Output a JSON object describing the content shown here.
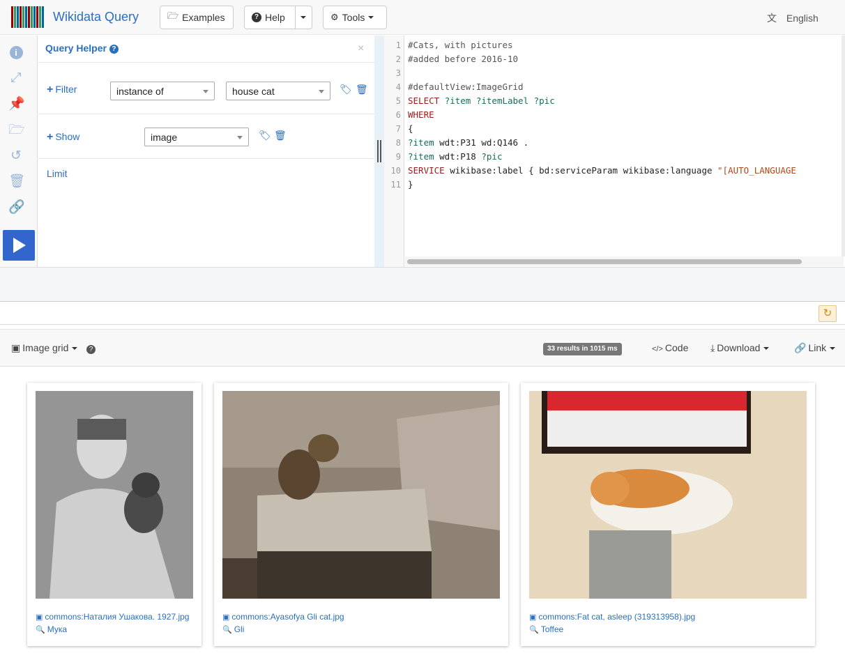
{
  "navbar": {
    "brand": "Wikidata Query",
    "examples_label": "Examples",
    "help_label": "Help",
    "tools_label": "Tools",
    "language_label": "English",
    "logo_colors": [
      "#990000",
      "#339966",
      "#006699",
      "#990000",
      "#339966",
      "#006699",
      "#990000",
      "#339966",
      "#006699",
      "#990000",
      "#339966",
      "#006699"
    ]
  },
  "sidebar": {
    "icons": [
      "info-icon",
      "expand-icon",
      "pin-icon",
      "folder-open-icon",
      "history-icon",
      "trash-icon",
      "link-icon"
    ]
  },
  "query_helper": {
    "title": "Query Helper",
    "help_mark": "?",
    "close": "×",
    "filter_label": "Filter",
    "filter_property": "instance of",
    "filter_value": "house cat",
    "show_label": "Show",
    "show_value": "image",
    "limit_label": "Limit"
  },
  "editor": {
    "line_numbers": [
      "1",
      "2",
      "3",
      "4",
      "5",
      "6",
      "7",
      "8",
      "9",
      "10",
      "11"
    ],
    "lines": [
      [
        {
          "t": "#Cats, with pictures",
          "c": "cm-comment"
        }
      ],
      [
        {
          "t": "#added before 2016-10",
          "c": "cm-comment"
        }
      ],
      [
        {
          "t": "",
          "c": "cm-plain"
        }
      ],
      [
        {
          "t": "#defaultView:ImageGrid",
          "c": "cm-comment"
        }
      ],
      [
        {
          "t": "SELECT ",
          "c": "cm-kw"
        },
        {
          "t": "?item ?itemLabel ?pic",
          "c": "cm-var"
        }
      ],
      [
        {
          "t": "WHERE",
          "c": "cm-kw"
        }
      ],
      [
        {
          "t": "{",
          "c": "cm-plain"
        }
      ],
      [
        {
          "t": "?item ",
          "c": "cm-var"
        },
        {
          "t": "wdt:P31 wd:Q146 .",
          "c": "cm-plain"
        }
      ],
      [
        {
          "t": "?item ",
          "c": "cm-var"
        },
        {
          "t": "wdt:P18 ",
          "c": "cm-plain"
        },
        {
          "t": "?pic",
          "c": "cm-var"
        }
      ],
      [
        {
          "t": "SERVICE ",
          "c": "cm-kw"
        },
        {
          "t": "wikibase:label { bd:serviceParam wikibase:language ",
          "c": "cm-plain"
        },
        {
          "t": "\"[AUTO_LANGUAGE",
          "c": "cm-str"
        }
      ],
      [
        {
          "t": "}",
          "c": "cm-plain"
        }
      ]
    ]
  },
  "results_toolbar": {
    "view_label": "Image grid",
    "help_mark": "?",
    "results_badge": "33 results in 1015 ms",
    "code_label": "Code",
    "download_label": "Download",
    "link_label": "Link"
  },
  "grid": [
    {
      "file": "commons:Наталия Ушакова. 1927.jpg",
      "label": "Мука"
    },
    {
      "file": "commons:Ayasofya Gli cat.jpg",
      "label": "Gli"
    },
    {
      "file": "commons:Fat cat, asleep (319313958).jpg",
      "label": "Toffee"
    }
  ]
}
